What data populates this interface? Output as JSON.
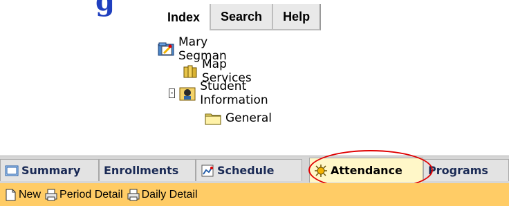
{
  "top_nav": {
    "tabs": [
      "Index",
      "Search",
      "Help"
    ],
    "active": "Index"
  },
  "tree": {
    "nodes": [
      {
        "label": "Mary Segman",
        "icon": "user-folder-icon",
        "level": 0
      },
      {
        "label": "Map Services",
        "icon": "map-services-icon",
        "level": 1
      },
      {
        "label": "Student Information",
        "icon": "student-info-icon",
        "level": 1,
        "expanded": true
      },
      {
        "label": "General",
        "icon": "folder-icon",
        "level": 2
      }
    ]
  },
  "tabs": {
    "items": [
      {
        "label": "Summary",
        "icon": "summary-icon"
      },
      {
        "label": "Enrollments",
        "icon": ""
      },
      {
        "label": "Schedule",
        "icon": "schedule-icon"
      },
      {
        "label": "Attendance",
        "icon": "attendance-icon"
      },
      {
        "label": "Programs",
        "icon": ""
      }
    ],
    "active": "Attendance"
  },
  "toolbar": {
    "items": [
      {
        "label": "New",
        "icon": "new-document-icon"
      },
      {
        "label": "Period Detail",
        "icon": "printer-icon"
      },
      {
        "label": "Daily Detail",
        "icon": "printer-icon"
      }
    ]
  },
  "colors": {
    "toolbar_bg": "#ffcc66",
    "highlight": "#e00000",
    "tab_text": "#1a2a55"
  }
}
